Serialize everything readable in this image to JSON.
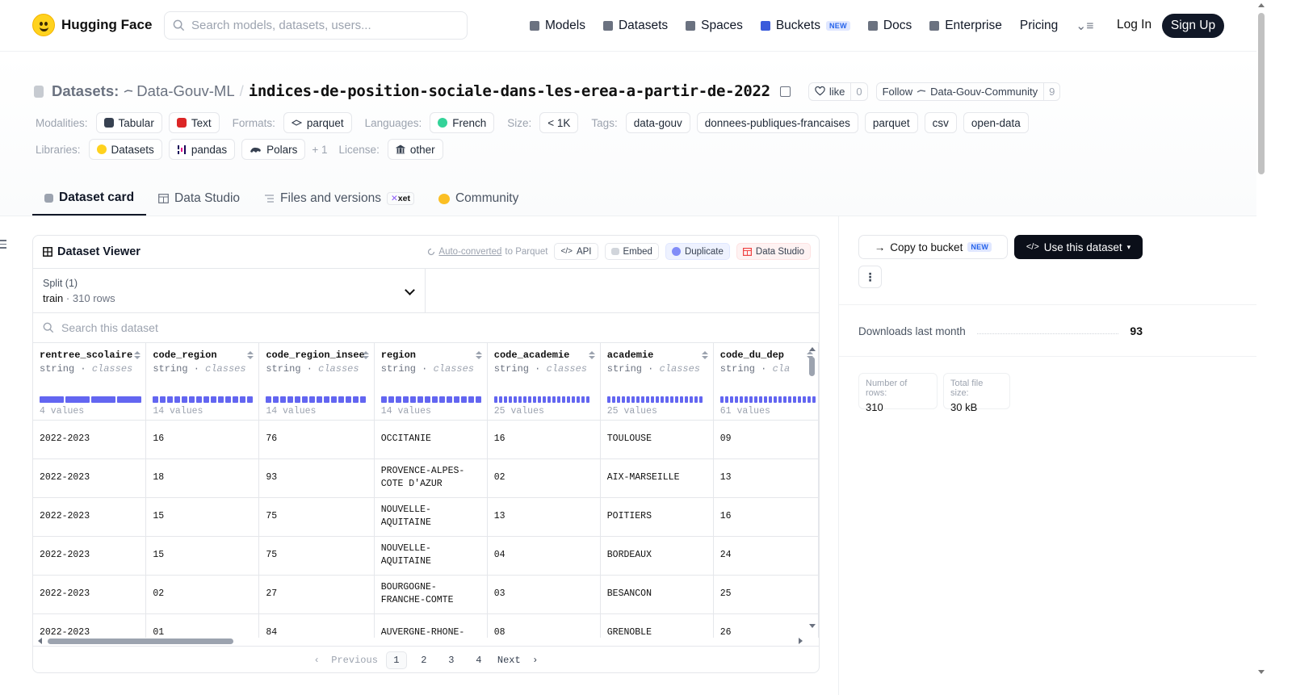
{
  "nav": {
    "brand": "Hugging Face",
    "search_placeholder": "Search models, datasets, users...",
    "links": [
      {
        "label": "Models",
        "icon": "models-icon",
        "color": "#6b7280"
      },
      {
        "label": "Datasets",
        "icon": "datasets-icon",
        "color": "#6b7280"
      },
      {
        "label": "Spaces",
        "icon": "spaces-icon",
        "color": "#6b7280"
      },
      {
        "label": "Buckets",
        "icon": "buckets-icon",
        "color": "#3b5bdb",
        "badge": "NEW"
      },
      {
        "label": "Docs",
        "icon": "docs-icon",
        "color": "#6b7280"
      },
      {
        "label": "Enterprise",
        "icon": "enterprise-icon",
        "color": "#6b7280"
      },
      {
        "label": "Pricing"
      }
    ],
    "login": "Log In",
    "signup": "Sign Up"
  },
  "header": {
    "section": "Datasets:",
    "org": "Data-Gouv-ML",
    "slash": "/",
    "name": "indices-de-position-sociale-dans-les-erea-a-partir-de-2022",
    "like_label": "like",
    "like_count": "0",
    "follow_label": "Follow",
    "follow_org": "Data-Gouv-Community",
    "follow_count": "9"
  },
  "meta": {
    "modalities_label": "Modalities:",
    "modalities": [
      "Tabular",
      "Text"
    ],
    "formats_label": "Formats:",
    "formats": [
      "parquet"
    ],
    "languages_label": "Languages:",
    "languages": [
      "French"
    ],
    "size_label": "Size:",
    "size": "< 1K",
    "tags_label": "Tags:",
    "tags": [
      "data-gouv",
      "donnees-publiques-francaises",
      "parquet",
      "csv",
      "open-data"
    ],
    "libraries_label": "Libraries:",
    "libraries": [
      "Datasets",
      "pandas",
      "Polars"
    ],
    "libraries_more": "+ 1",
    "license_label": "License:",
    "license": "other"
  },
  "tabs": [
    {
      "label": "Dataset card",
      "active": true
    },
    {
      "label": "Data Studio"
    },
    {
      "label": "Files and versions",
      "badge": "xet"
    },
    {
      "label": "Community"
    }
  ],
  "viewer": {
    "title": "Dataset Viewer",
    "auto_converted": "Auto-converted",
    "to_parquet": " to Parquet",
    "api": "API",
    "embed": "Embed",
    "duplicate": "Duplicate",
    "data_studio": "Data Studio",
    "split_label": "Split (1)",
    "split_name": "train",
    "split_sep": "·",
    "split_rows": "310 rows",
    "search_placeholder": "Search this dataset",
    "columns": [
      {
        "name": "rentree_scolaire",
        "type": "string",
        "kind": "classes",
        "values": "4 values",
        "distinct": 4
      },
      {
        "name": "code_region",
        "type": "string",
        "kind": "classes",
        "values": "14 values",
        "distinct": 14
      },
      {
        "name": "code_region_insee",
        "type": "string",
        "kind": "classes",
        "values": "14 values",
        "distinct": 14
      },
      {
        "name": "region",
        "type": "string",
        "kind": "classes",
        "values": "14 values",
        "distinct": 14
      },
      {
        "name": "code_academie",
        "type": "string",
        "kind": "classes",
        "values": "25 values",
        "distinct": 25
      },
      {
        "name": "academie",
        "type": "string",
        "kind": "classes",
        "values": "25 values",
        "distinct": 25
      },
      {
        "name": "code_du_dep",
        "type": "string",
        "kind": "cla",
        "values": "61 values",
        "distinct": 61
      }
    ],
    "rows": [
      [
        "2022-2023",
        "16",
        "76",
        "OCCITANIE",
        "16",
        "TOULOUSE",
        "09"
      ],
      [
        "2022-2023",
        "18",
        "93",
        "PROVENCE-ALPES-COTE D'AZUR",
        "02",
        "AIX-MARSEILLE",
        "13"
      ],
      [
        "2022-2023",
        "15",
        "75",
        "NOUVELLE-AQUITAINE",
        "13",
        "POITIERS",
        "16"
      ],
      [
        "2022-2023",
        "15",
        "75",
        "NOUVELLE-AQUITAINE",
        "04",
        "BORDEAUX",
        "24"
      ],
      [
        "2022-2023",
        "02",
        "27",
        "BOURGOGNE-FRANCHE-COMTE",
        "03",
        "BESANCON",
        "25"
      ],
      [
        "2022-2023",
        "01",
        "84",
        "AUVERGNE-RHONE-",
        "08",
        "GRENOBLE",
        "26"
      ]
    ],
    "pager": {
      "prev": "Previous",
      "pages": [
        "1",
        "2",
        "3",
        "4"
      ],
      "current": "1",
      "next": "Next"
    }
  },
  "side": {
    "copy_bucket": "Copy to bucket",
    "copy_badge": "NEW",
    "use_dataset": "Use this dataset",
    "more": "⋮",
    "downloads_label": "Downloads last month",
    "downloads": "93",
    "rows_label": "Number of rows:",
    "rows_value": "310",
    "size_label": "Total file size:",
    "size_value": "30 kB"
  },
  "colors": {
    "accent": "#6366f1",
    "brand": "#ffd21e",
    "dark": "#111827"
  }
}
